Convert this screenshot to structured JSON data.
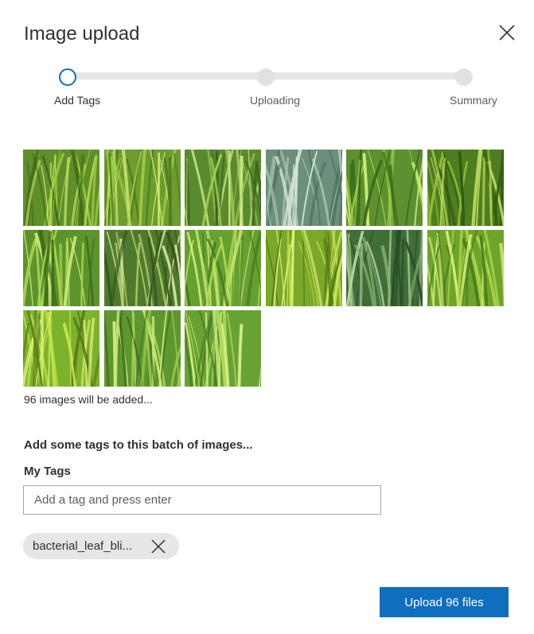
{
  "dialog": {
    "title": "Image upload"
  },
  "steps": [
    {
      "label": "Add Tags",
      "state": "active"
    },
    {
      "label": "Uploading",
      "state": "pending"
    },
    {
      "label": "Summary",
      "state": "pending"
    }
  ],
  "thumbnails": [
    {
      "icon": "grass-photo"
    },
    {
      "icon": "grass-photo"
    },
    {
      "icon": "grass-photo"
    },
    {
      "icon": "grass-photo"
    },
    {
      "icon": "grass-photo"
    },
    {
      "icon": "grass-photo"
    },
    {
      "icon": "grass-photo"
    },
    {
      "icon": "grass-photo"
    },
    {
      "icon": "grass-photo"
    },
    {
      "icon": "grass-photo"
    },
    {
      "icon": "grass-photo"
    },
    {
      "icon": "grass-photo"
    },
    {
      "icon": "grass-photo"
    },
    {
      "icon": "grass-photo"
    },
    {
      "icon": "grass-photo"
    }
  ],
  "images_count_text": "96 images will be added...",
  "tags": {
    "batch_label": "Add some tags to this batch of images...",
    "my_tags_label": "My Tags",
    "input_placeholder": "Add a tag and press enter",
    "input_value": "",
    "chips": [
      {
        "label": "bacterial_leaf_bli..."
      }
    ]
  },
  "footer": {
    "upload_button_label": "Upload 96 files"
  },
  "colors": {
    "accent": "#106ebe",
    "track": "#e6e6e6",
    "chip": "#e6e6e6"
  }
}
